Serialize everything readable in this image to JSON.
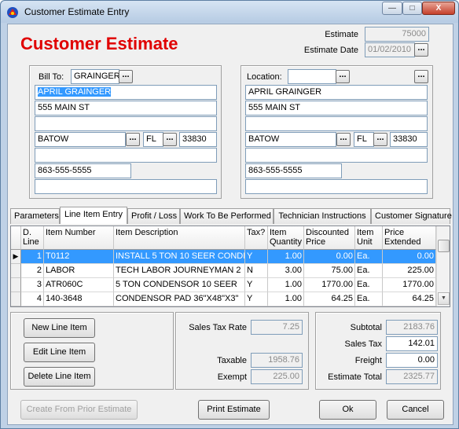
{
  "window": {
    "title": "Customer Estimate Entry",
    "controls": [
      "—",
      "□",
      "X"
    ]
  },
  "heading": "Customer Estimate",
  "estimate": {
    "label": "Estimate",
    "number": "75000",
    "date_label": "Estimate Date",
    "date": "01/02/2010"
  },
  "bill_to": {
    "label": "Bill To:",
    "code": "GRAINGER",
    "name": "APRIL GRAINGER",
    "address1": "555 MAIN ST",
    "address2": "",
    "city": "BATOW",
    "state": "FL",
    "zip": "33830",
    "extra": "",
    "phone": "863-555-5555",
    "notes": ""
  },
  "location": {
    "label": "Location:",
    "code": "",
    "name": "APRIL GRAINGER",
    "address1": "555 MAIN ST",
    "address2": "",
    "city": "BATOW",
    "state": "FL",
    "zip": "33830",
    "extra": "",
    "phone": "863-555-5555",
    "notes": ""
  },
  "tabs": [
    "Parameters",
    "Line Item Entry",
    "Profit / Loss",
    "Work To Be Performed",
    "Technician Instructions",
    "Customer Signature"
  ],
  "active_tab": "Line Item Entry",
  "grid": {
    "headers": [
      "D. Line",
      "Item Number",
      "Item Description",
      "Tax?",
      "Item Quantity",
      "Discounted Price",
      "Item Unit",
      "Price Extended"
    ],
    "rows": [
      {
        "line": "1",
        "item": "T0112",
        "desc": "INSTALL 5 TON 10 SEER CONDE",
        "tax": "Y",
        "qty": "1.00",
        "price": "0.00",
        "unit": "Ea.",
        "ext": "0.00"
      },
      {
        "line": "2",
        "item": "LABOR",
        "desc": "TECH LABOR JOURNEYMAN 2",
        "tax": "N",
        "qty": "3.00",
        "price": "75.00",
        "unit": "Ea.",
        "ext": "225.00"
      },
      {
        "line": "3",
        "item": "ATR060C",
        "desc": "5 TON CONDENSOR 10 SEER",
        "tax": "Y",
        "qty": "1.00",
        "price": "1770.00",
        "unit": "Ea.",
        "ext": "1770.00"
      },
      {
        "line": "4",
        "item": "140-3648",
        "desc": "CONDENSOR PAD 36\"X48\"X3\"",
        "tax": "Y",
        "qty": "1.00",
        "price": "64.25",
        "unit": "Ea.",
        "ext": "64.25"
      }
    ],
    "indicator": "▶"
  },
  "actions": {
    "new": "New Line Item",
    "edit": "Edit Line Item",
    "delete": "Delete Line Item"
  },
  "tax": {
    "rate_label": "Sales Tax Rate",
    "rate": "7.25",
    "taxable_label": "Taxable",
    "taxable": "1958.76",
    "exempt_label": "Exempt",
    "exempt": "225.00"
  },
  "totals": {
    "subtotal_label": "Subtotal",
    "subtotal": "2183.76",
    "salestax_label": "Sales Tax",
    "salestax": "142.01",
    "freight_label": "Freight",
    "freight": "0.00",
    "total_label": "Estimate Total",
    "total": "2325.77"
  },
  "footer": {
    "prior": "Create From Prior Estimate",
    "print": "Print Estimate",
    "ok": "Ok",
    "cancel": "Cancel"
  },
  "colors": {
    "heading": "#e00000",
    "selection": "#3399ff"
  }
}
